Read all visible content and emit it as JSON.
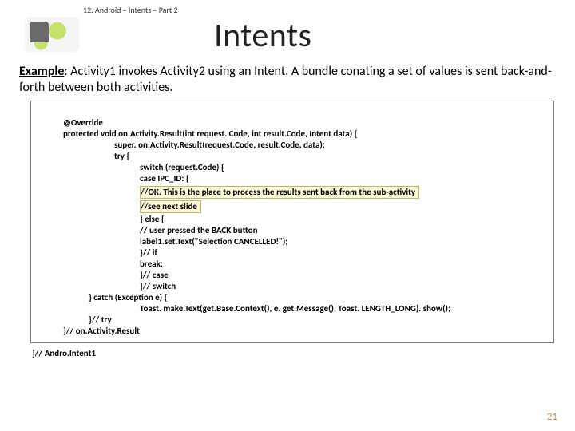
{
  "header": {
    "breadcrumb": "12. Android – Intents – Part 2"
  },
  "title": "Intents",
  "example": {
    "lead": "Example",
    "body": ": Activity1 invokes Activity2 using an Intent. A bundle conating a set of values is sent back-and-forth between both activities."
  },
  "code": {
    "l01": "@Override",
    "l02": "protected void on.Activity.Result(int request. Code, int result.Code, Intent data) {",
    "l03": "super. on.Activity.Result(request.Code, result.Code, data);",
    "l04": "try {",
    "l05": "switch (request.Code) {",
    "l06": "case IPC_ID: {",
    "l07": "//OK. This is the place to process the results sent back from the sub-activity",
    "l08": "//see next slide",
    "l09": "} else {",
    "l10": "// user pressed the BACK button",
    "l11": "label1.set.Text(\"Selection CANCELLED!\");",
    "l12": "}// if",
    "l13": "break;",
    "l14": "}// case",
    "l15": "}// switch",
    "l16": "} catch (Exception e) {",
    "l17": "Toast. make.Text(get.Base.Context(), e. get.Message(), Toast. LENGTH_LONG). show();",
    "l18": "}// try",
    "l19": "}// on.Activity.Result"
  },
  "closing": "}// Andro.Intent1",
  "page": "21"
}
